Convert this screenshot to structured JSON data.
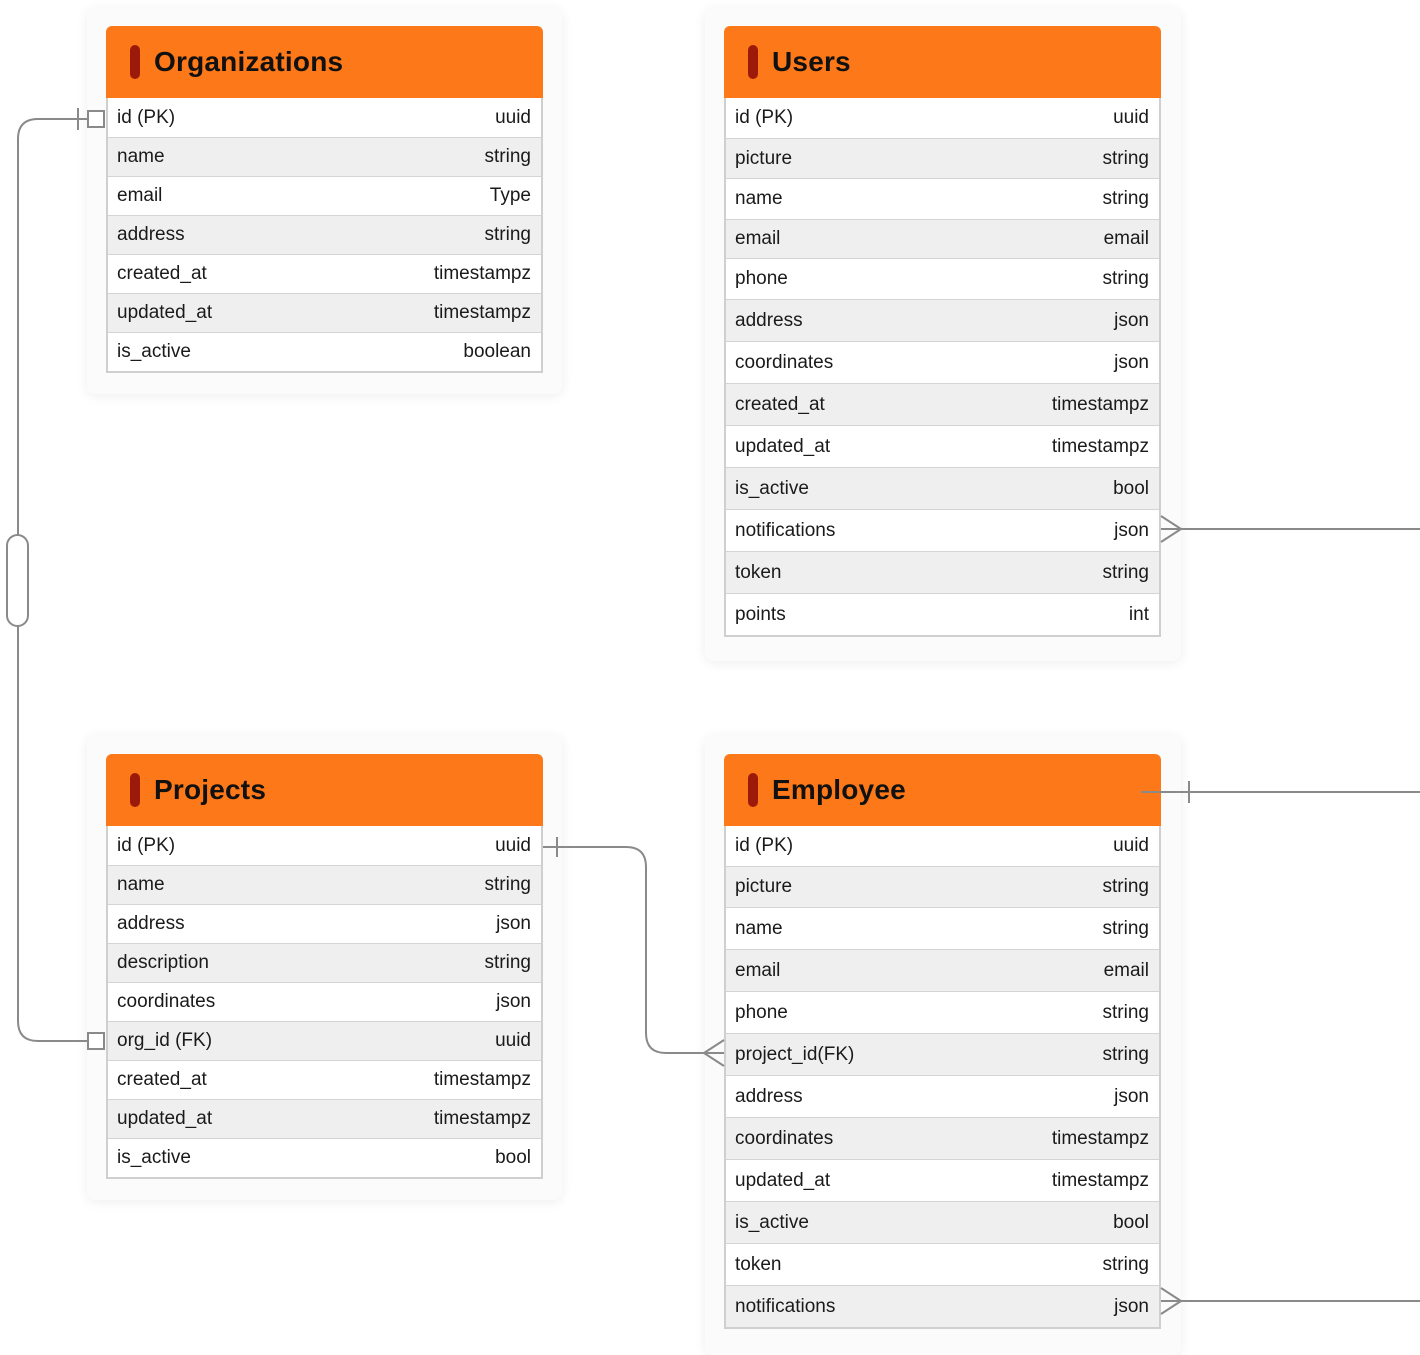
{
  "entities": {
    "organizations": {
      "title": "Organizations",
      "fields": [
        {
          "name": "id (PK)",
          "type": "uuid"
        },
        {
          "name": "name",
          "type": "string"
        },
        {
          "name": "email",
          "type": "Type"
        },
        {
          "name": "address",
          "type": "string"
        },
        {
          "name": "created_at",
          "type": "timestampz"
        },
        {
          "name": "updated_at",
          "type": "timestampz"
        },
        {
          "name": "is_active",
          "type": "boolean"
        }
      ]
    },
    "users": {
      "title": "Users",
      "fields": [
        {
          "name": "id (PK)",
          "type": "uuid"
        },
        {
          "name": "picture",
          "type": "string"
        },
        {
          "name": "name",
          "type": "string"
        },
        {
          "name": "email",
          "type": "email"
        },
        {
          "name": "phone",
          "type": "string"
        },
        {
          "name": "address",
          "type": "json"
        },
        {
          "name": "coordinates",
          "type": "json"
        },
        {
          "name": "created_at",
          "type": "timestampz"
        },
        {
          "name": "updated_at",
          "type": "timestampz"
        },
        {
          "name": "is_active",
          "type": "bool"
        },
        {
          "name": "notifications",
          "type": "json"
        },
        {
          "name": "token",
          "type": "string"
        },
        {
          "name": "points",
          "type": "int"
        }
      ]
    },
    "projects": {
      "title": "Projects",
      "fields": [
        {
          "name": "id (PK)",
          "type": "uuid"
        },
        {
          "name": "name",
          "type": "string"
        },
        {
          "name": "address",
          "type": "json"
        },
        {
          "name": "description",
          "type": "string"
        },
        {
          "name": "coordinates",
          "type": "json"
        },
        {
          "name": "org_id (FK)",
          "type": "uuid"
        },
        {
          "name": "created_at",
          "type": "timestampz"
        },
        {
          "name": "updated_at",
          "type": "timestampz"
        },
        {
          "name": "is_active",
          "type": "bool"
        }
      ]
    },
    "employee": {
      "title": "Employee",
      "fields": [
        {
          "name": "id (PK)",
          "type": "uuid"
        },
        {
          "name": "picture",
          "type": "string"
        },
        {
          "name": "name",
          "type": "string"
        },
        {
          "name": "email",
          "type": "email"
        },
        {
          "name": "phone",
          "type": "string"
        },
        {
          "name": "project_id(FK)",
          "type": "string"
        },
        {
          "name": "address",
          "type": "json"
        },
        {
          "name": "coordinates",
          "type": "timestampz"
        },
        {
          "name": "updated_at",
          "type": "timestampz"
        },
        {
          "name": "is_active",
          "type": "bool"
        },
        {
          "name": "token",
          "type": "string"
        },
        {
          "name": "notifications",
          "type": "json"
        }
      ]
    }
  },
  "colors": {
    "header": "#fd7818",
    "header_bar": "#9c1a0a",
    "connector": "#8a8a8a"
  }
}
